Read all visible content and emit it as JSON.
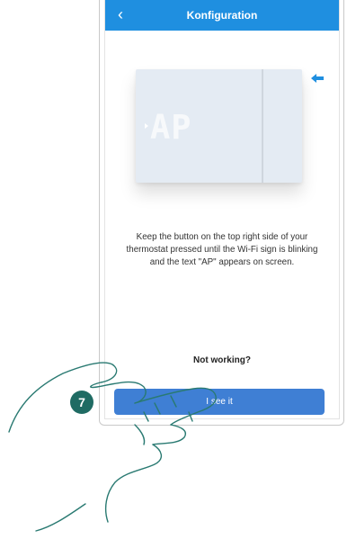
{
  "header": {
    "title": "Konfiguration"
  },
  "device": {
    "display_text": "AP"
  },
  "instruction": {
    "lines": [
      "Keep the button on the top right side of your",
      "thermostat pressed until the Wi-Fi sign is blinking",
      "and the text \"AP\" appears on screen."
    ]
  },
  "links": {
    "not_working": "Not working?"
  },
  "actions": {
    "primary_label": "I see it"
  },
  "step": {
    "number": "7"
  },
  "colors": {
    "header": "#1f8fe0",
    "button": "#3f7fd4",
    "badge": "#1f6b63"
  },
  "icons": {
    "back": "chevron-left-icon",
    "pointer": "arrow-left-icon"
  }
}
